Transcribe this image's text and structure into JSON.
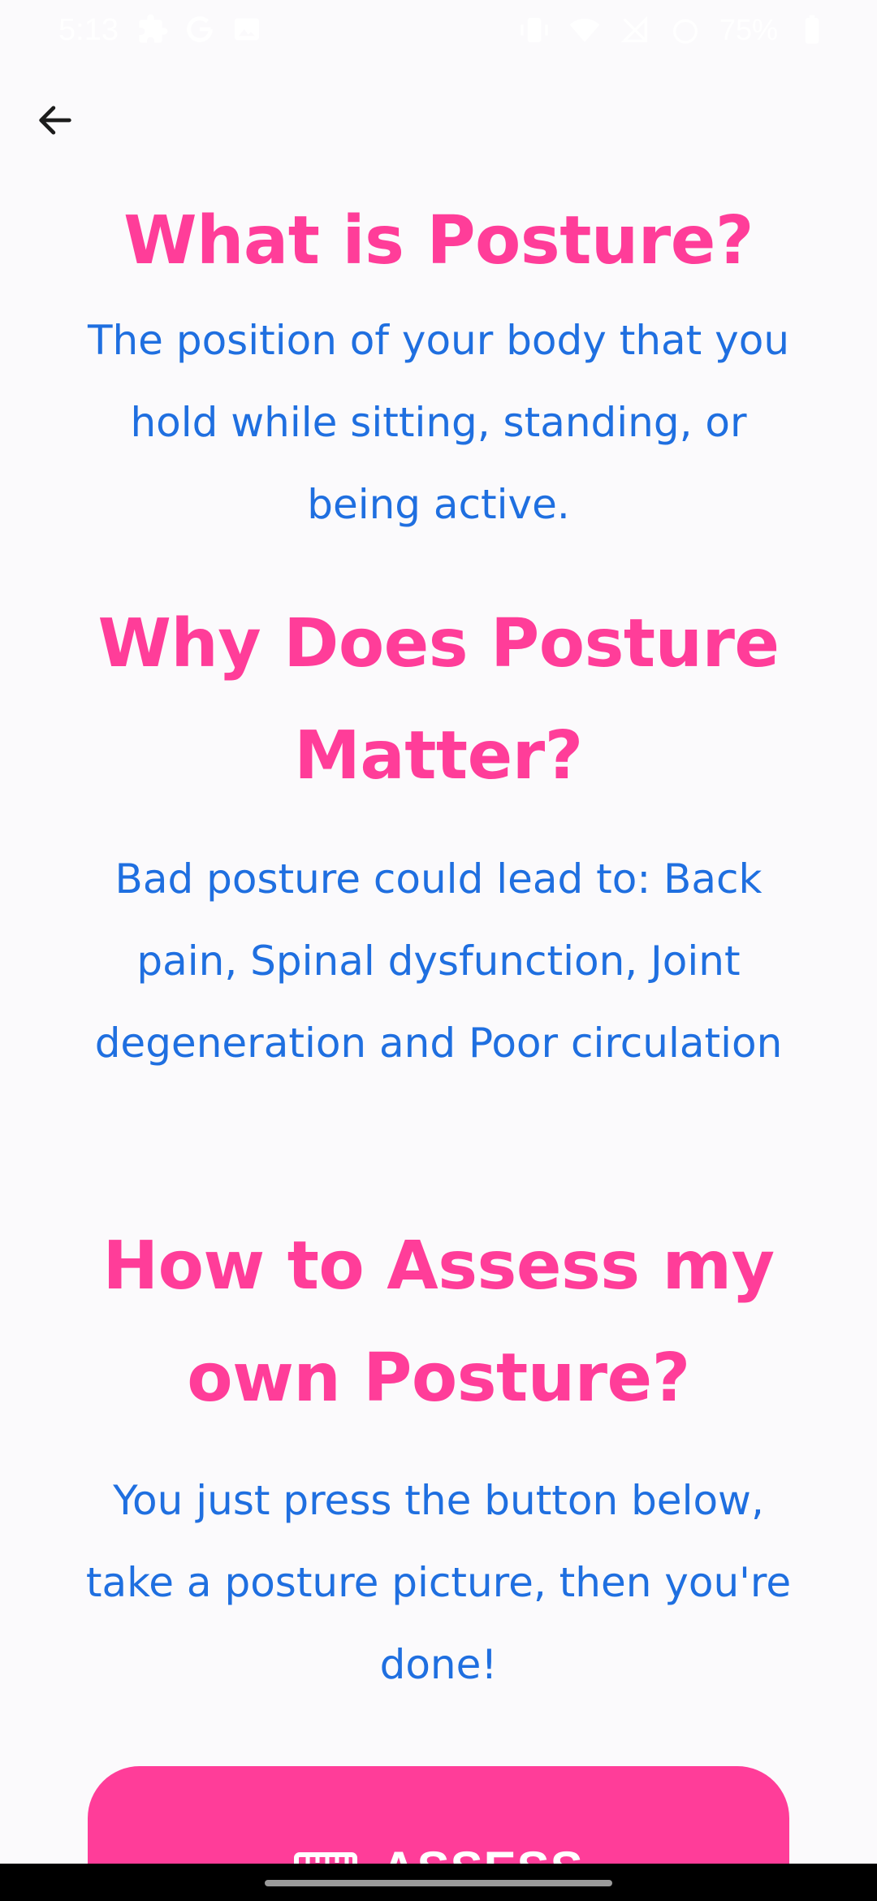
{
  "status_bar": {
    "time": "5:13",
    "battery": "75%",
    "left_icons": [
      "puzzle-icon",
      "google-icon",
      "image-icon"
    ],
    "right_icons": [
      "vibrate-icon",
      "wifi-icon",
      "no-signal-icon",
      "alarm-icon",
      "battery-icon"
    ]
  },
  "nav": {
    "back_icon": "arrow-back-icon"
  },
  "sections": [
    {
      "heading": "What is Posture?",
      "body": "The position of your body that you hold while sitting, standing, or being active."
    },
    {
      "heading": "Why Does Posture Matter?",
      "body": "Bad posture could lead to: Back pain, Spinal dysfunction, Joint degeneration and Poor circulation"
    },
    {
      "heading": "How to Assess my own Posture?",
      "body": "You just press the button below, take a posture picture, then you're done!"
    }
  ],
  "assess_button": {
    "label": "ASSESS",
    "icon": "ruler-icon"
  },
  "colors": {
    "heading": "#ff3d99",
    "body": "#1f6fe0",
    "button": "#ff3d99",
    "background": "#fbfafc"
  }
}
